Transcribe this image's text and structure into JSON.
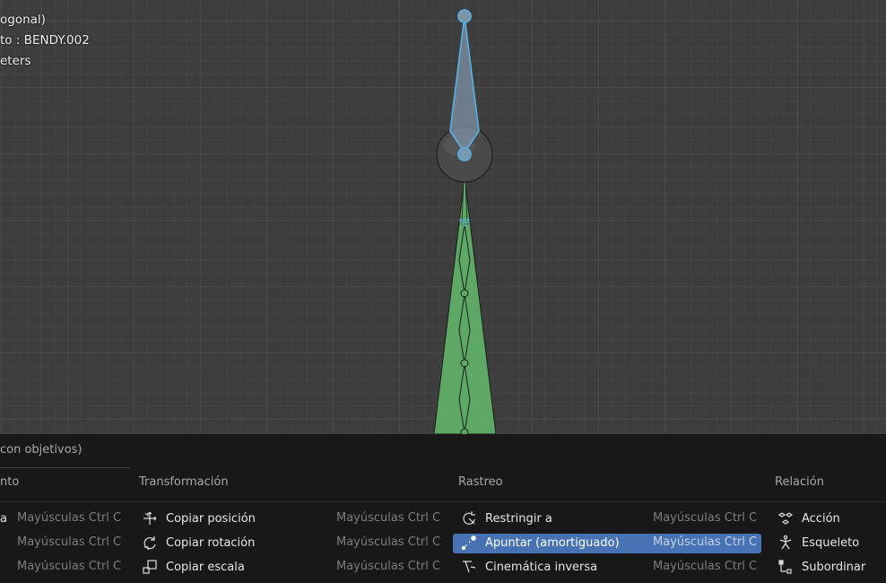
{
  "viewport": {
    "overlay_lines": [
      "ogonal)",
      "to : BENDY.002",
      "eters"
    ]
  },
  "menu": {
    "title": "con objetivos)",
    "left_column": {
      "header": "nto",
      "rows": [
        {
          "label": "a",
          "shortcut": "Mayúsculas Ctrl C"
        },
        {
          "label": "",
          "shortcut": "Mayúsculas Ctrl C"
        },
        {
          "label": "",
          "shortcut": "Mayúsculas Ctrl C"
        }
      ]
    },
    "transform_column": {
      "header": "Transformación",
      "items": [
        {
          "label": "Copiar posición",
          "shortcut": "Mayúsculas Ctrl C",
          "icon": "copy-location-icon"
        },
        {
          "label": "Copiar rotación",
          "shortcut": "Mayúsculas Ctrl C",
          "icon": "copy-rotation-icon"
        },
        {
          "label": "Copiar escala",
          "shortcut": "Mayúsculas Ctrl C",
          "icon": "copy-scale-icon"
        }
      ]
    },
    "tracking_column": {
      "header": "Rastreo",
      "items": [
        {
          "label": "Restringir a",
          "shortcut": "Mayúsculas Ctrl C",
          "icon": "track-to-icon"
        },
        {
          "label": "Apuntar (amortiguado)",
          "shortcut": "Mayúsculas Ctrl C",
          "icon": "damped-track-icon",
          "highlighted": true
        },
        {
          "label": "Cinemática inversa",
          "shortcut": "Mayúsculas Ctrl C",
          "icon": "inverse-kinematics-icon"
        }
      ]
    },
    "relation_column": {
      "header": "Relación",
      "items": [
        {
          "label": "Acción",
          "icon": "action-icon"
        },
        {
          "label": "Esqueleto",
          "icon": "armature-icon"
        },
        {
          "label": "Subordinar",
          "icon": "child-of-icon"
        }
      ]
    },
    "colors": {
      "highlight": "#4772b3",
      "bone_selected": "#58b2e6",
      "bone_green": "#5da864"
    }
  }
}
